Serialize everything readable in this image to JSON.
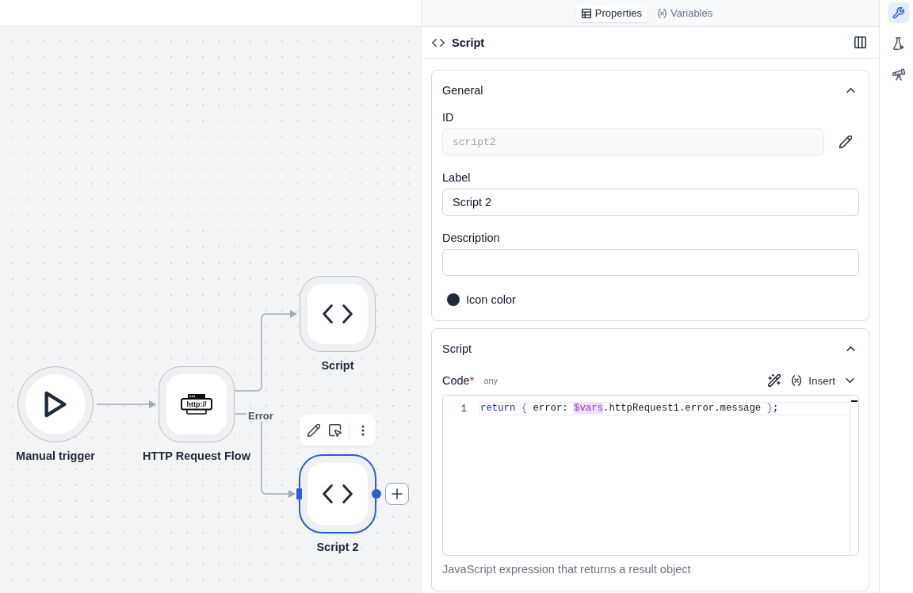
{
  "canvas": {
    "nodes": [
      {
        "kind": "trigger",
        "label": "Manual trigger",
        "selected": false
      },
      {
        "kind": "http",
        "label": "HTTP Request Flow",
        "icon_text": "http://",
        "error_label": "Error",
        "selected": false
      },
      {
        "kind": "script",
        "label": "Script",
        "selected": false
      },
      {
        "kind": "script",
        "label": "Script 2",
        "selected": true
      }
    ]
  },
  "panel": {
    "tabs": [
      {
        "label": "Properties",
        "selected": true
      },
      {
        "label": "Variables",
        "selected": false
      }
    ],
    "title": "Script",
    "general": {
      "title": "General",
      "expanded": true,
      "id": {
        "label": "ID",
        "value": "script2",
        "disabled": true
      },
      "name": {
        "label": "Label",
        "value": "Script 2"
      },
      "description": {
        "label": "Description"
      },
      "icon_color": {
        "label": "Icon color",
        "color": "#1f2937"
      }
    },
    "script": {
      "title": "Script",
      "expanded": true,
      "code": {
        "label": "Code",
        "required_mark": "*",
        "type": "any",
        "insert": "Insert",
        "lines": [
          {
            "number": "1",
            "active": true,
            "tokens": [
              {
                "kind": "keyword",
                "text": "return"
              },
              {
                "kind": "bracket",
                "text": " {"
              },
              {
                "kind": "plain",
                "text": " error: "
              },
              {
                "kind": "variable",
                "text": "$vars"
              },
              {
                "kind": "plain",
                "text": ".httpRequest1.error.message "
              },
              {
                "kind": "bracket",
                "text": "}"
              },
              {
                "kind": "plain",
                "text": ";"
              }
            ]
          }
        ]
      },
      "help": "JavaScript expression that returns a result object"
    }
  },
  "sidebar": {
    "items": [
      {
        "selected": true
      },
      {
        "selected": false
      },
      {
        "selected": false
      }
    ]
  }
}
